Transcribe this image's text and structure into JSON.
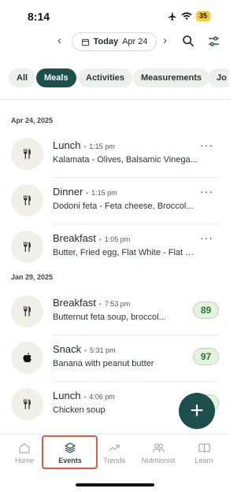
{
  "status_bar": {
    "time": "8:14",
    "battery": "35"
  },
  "date_nav": {
    "prev": "‹",
    "next": "›",
    "today": "Today",
    "date": "Apr 24"
  },
  "filters": [
    {
      "label": "All",
      "active": false
    },
    {
      "label": "Meals",
      "active": true
    },
    {
      "label": "Activities",
      "active": false
    },
    {
      "label": "Measurements",
      "active": false
    },
    {
      "label": "Jo",
      "active": false
    }
  ],
  "sections": [
    {
      "date": "Apr 24, 2025",
      "entries": [
        {
          "name": "Lunch",
          "time": "1:15 pm",
          "desc": "Kalamata - Olives, Balsamic Vinega...",
          "icon": "utensils-icon",
          "score": null
        },
        {
          "name": "Dinner",
          "time": "1:15 pm",
          "desc": "Dodoni feta - Feta cheese, Broccol...",
          "icon": "utensils-icon",
          "score": null
        },
        {
          "name": "Breakfast",
          "time": "1:05 pm",
          "desc": "Butter, Fried egg, Flat White - Flat W...",
          "icon": "utensils-icon",
          "score": null
        }
      ]
    },
    {
      "date": "Jan 29, 2025",
      "entries": [
        {
          "name": "Breakfast",
          "time": "7:53 pm",
          "desc": "Butternut feta soup, broccol...",
          "icon": "utensils-icon",
          "score": "89"
        },
        {
          "name": "Snack",
          "time": "5:31 pm",
          "desc": "Banana with peanut butter",
          "icon": "apple-icon",
          "score": "97"
        },
        {
          "name": "Lunch",
          "time": "4:06 pm",
          "desc": "Chicken soup",
          "icon": "utensils-icon",
          "score": "9"
        }
      ]
    }
  ],
  "fab": {
    "label": "+"
  },
  "tabs": [
    {
      "label": "Home",
      "icon": "home-icon",
      "active": false
    },
    {
      "label": "Events",
      "icon": "layers-icon",
      "active": true
    },
    {
      "label": "Trends",
      "icon": "trend-icon",
      "active": false
    },
    {
      "label": "Nutritionist",
      "icon": "people-icon",
      "active": false
    },
    {
      "label": "Learn",
      "icon": "book-icon",
      "active": false
    }
  ],
  "colors": {
    "accent": "#1d4f4d",
    "score_bg": "#e3f3df",
    "score_text": "#2b7a2b",
    "highlight": "#e05a3c"
  }
}
